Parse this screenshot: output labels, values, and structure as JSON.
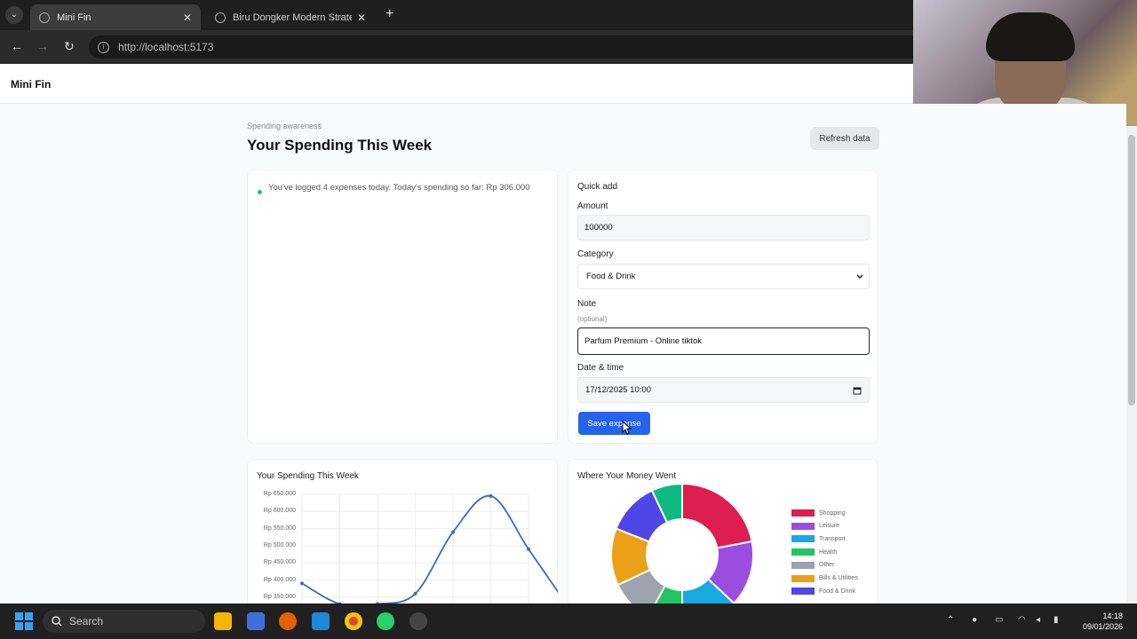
{
  "browser": {
    "tabs": [
      {
        "label": "Mini Fin",
        "close": "✕"
      },
      {
        "label": "Biru Dongker Modern Strategi Bisnis",
        "close": "✕"
      }
    ],
    "new_tab": "+",
    "tab_list": "⌄",
    "url": "http://localhost:5173",
    "nav": {
      "back": "←",
      "forward": "→",
      "reload": "↻"
    }
  },
  "app": {
    "brand": "Mini Fin",
    "eyebrow": "Spending awareness",
    "title": "Your Spending This Week",
    "refresh_label": "Refresh data"
  },
  "status": {
    "text": "You've logged 4 expenses today. Today's spending so far: Rp 306.000"
  },
  "quick_add": {
    "title": "Quick add",
    "amount_label": "Amount",
    "amount_value": "100000",
    "category_label": "Category",
    "category_value": "Food & Drink",
    "note_label": "Note",
    "note_hint": "(optional)",
    "note_value": "Parfum Premium - Online tiktok",
    "datetime_label": "Date & time",
    "datetime_value": "17/12/2025 10:00",
    "save_label": "Save expense"
  },
  "line_chart": {
    "title": "Your Spending This Week"
  },
  "donut_chart": {
    "title": "Where Your Money Went"
  },
  "chart_data": [
    {
      "type": "line",
      "title": "Your Spending This Week",
      "y_tick_labels": [
        "Rp 650.000",
        "Rp 600.000",
        "Rp 550.000",
        "Rp 500.000",
        "Rp 450.000",
        "Rp 400.000",
        "Rp 350.000"
      ],
      "ylim": [
        350000,
        650000
      ],
      "x_index": [
        0,
        1,
        2,
        3,
        4,
        5,
        6
      ],
      "values": [
        390000,
        330000,
        330000,
        360000,
        540000,
        645000,
        490000,
        330000
      ],
      "grid": true,
      "color": "#3b6db3"
    },
    {
      "type": "pie",
      "title": "Where Your Money Went",
      "labels": [
        "Shopping",
        "Leisure",
        "Transport",
        "Health",
        "Other",
        "Bills & Utilities",
        "Food & Drink"
      ],
      "values": [
        22,
        15,
        13,
        8,
        10,
        13,
        12,
        7
      ],
      "colors": [
        "#dc1e50",
        "#9b4de0",
        "#17a9e1",
        "#22c55e",
        "#9ca3af",
        "#eba117",
        "#4f46e5",
        "#10b981"
      ],
      "legend": "right"
    }
  ],
  "taskbar": {
    "search_label": "Search",
    "time": "14:18",
    "date": "09/01/2026"
  }
}
